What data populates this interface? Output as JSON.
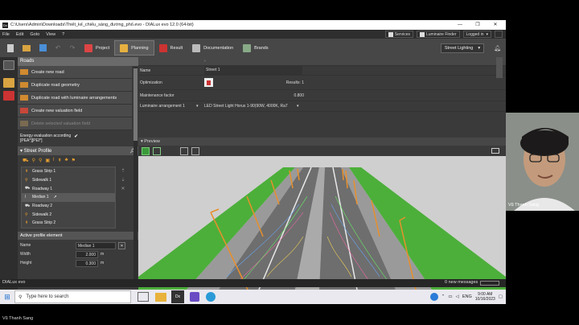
{
  "window": {
    "title": "C:\\Users\\Admin\\Downloads\\Thiết_kế_chiếu_sáng_đường_phố.evo - DIALux evo 12.0  (64-bit)",
    "app_icon": "Dx"
  },
  "menu": [
    "File",
    "Edit",
    "Goto",
    "View",
    "?"
  ],
  "topbar": {
    "services": "Services",
    "luminaire_finder": "Luminaire Finder",
    "logged_in": "Logged in"
  },
  "toolbar": {
    "tabs": [
      {
        "label": "Project",
        "icon": "project-icon"
      },
      {
        "label": "Planning",
        "icon": "planning-icon"
      },
      {
        "label": "Result",
        "icon": "result-icon"
      },
      {
        "label": "Documentation",
        "icon": "documentation-icon"
      },
      {
        "label": "Brands",
        "icon": "brands-icon"
      }
    ],
    "active_tab": "Planning",
    "mode_select": "Street Lighting"
  },
  "roads_panel": {
    "title": "Roads",
    "actions": [
      {
        "label": "Create new road",
        "enabled": true
      },
      {
        "label": "Duplicate road geometry",
        "enabled": true
      },
      {
        "label": "Duplicate road with luminaire arrangements",
        "enabled": true
      },
      {
        "label": "Create new valuation field",
        "enabled": true
      },
      {
        "label": "Delete selected valuation field",
        "enabled": false
      }
    ],
    "energy_eval_line1": "Energy evaluation according",
    "energy_eval_line2": "[PEA*][PEI*]",
    "energy_eval_checked": true
  },
  "street_profile": {
    "title": "Street Profile",
    "items": [
      {
        "label": "Grass Strip 1",
        "glyph": "⇞"
      },
      {
        "label": "Sidewalk 1",
        "glyph": "⚲"
      },
      {
        "label": "Roadway 1",
        "glyph": "⛟"
      },
      {
        "label": "Median 1",
        "glyph": "ǀ"
      },
      {
        "label": "Roadway 2",
        "glyph": "⛟"
      },
      {
        "label": "Sidewalk 2",
        "glyph": "⚲"
      },
      {
        "label": "Grass Strip 2",
        "glyph": "⇞"
      }
    ],
    "selected": "Median 1"
  },
  "active_profile": {
    "title": "Active profile element",
    "name_label": "Name",
    "name_value": "Median 1",
    "width_label": "Width",
    "width_value": "2.000",
    "width_unit": "m",
    "height_label": "Height",
    "height_value": "0.300",
    "height_unit": "m"
  },
  "properties": {
    "name_label": "Name",
    "name_value": "Street 1",
    "optimization_label": "Optimization",
    "results_label": "Results: 1",
    "maintenance_label": "Maintenance factor",
    "maintenance_value": "0.800",
    "luminaire_label": "Luminaire arrangement 1",
    "luminaire_value": "LED Street Light Horus 1-90(90W, 4000K, Ra7"
  },
  "preview": {
    "title": "Preview"
  },
  "status": {
    "app": "DIALux evo",
    "messages": "0 new messages"
  },
  "taskbar": {
    "search_placeholder": "Type here to search",
    "lang": "ENG",
    "time": "9:00 AM",
    "date": "10/16/2023"
  },
  "webcam": {
    "name": "Vũ Thanh Sang"
  },
  "caption": "Vũ Thanh Sang",
  "colors": {
    "accent_orange": "#e8902c",
    "grass": "#4caf3a",
    "active_tab": "#5a5a5a"
  }
}
